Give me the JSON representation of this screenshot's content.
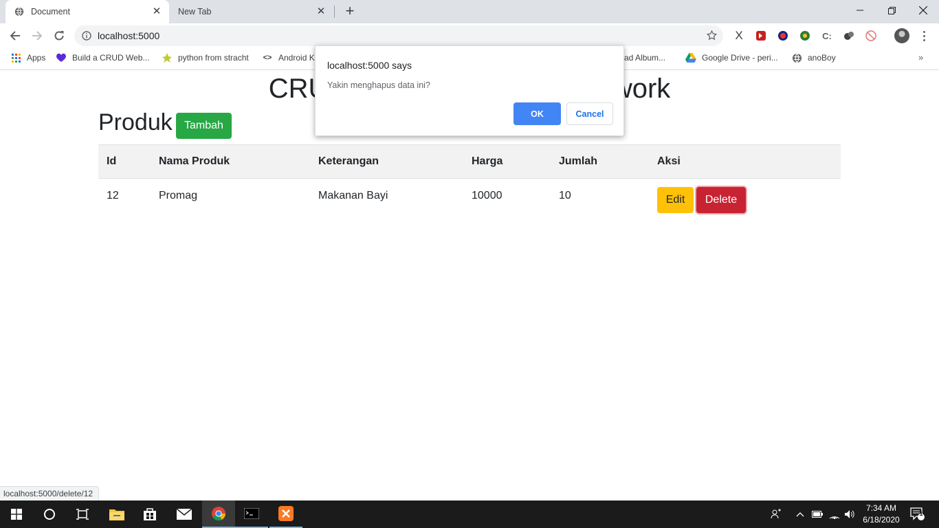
{
  "browser": {
    "tabs": [
      {
        "title": "Document"
      },
      {
        "title": "New Tab"
      }
    ],
    "url": "localhost:5000",
    "bookmarks": [
      {
        "label": "Apps"
      },
      {
        "label": "Build a CRUD Web..."
      },
      {
        "label": "python from stracht"
      },
      {
        "label": "Android K"
      },
      {
        "label": "ad Album..."
      },
      {
        "label": "Google Drive - peri..."
      },
      {
        "label": "anoBoy"
      }
    ],
    "status_url": "localhost:5000/delete/12"
  },
  "page": {
    "title": "CRUD Dengan Flask Framework",
    "section_title": "Produk",
    "add_button": "Tambah",
    "table": {
      "headers": [
        "Id",
        "Nama Produk",
        "Keterangan",
        "Harga",
        "Jumlah",
        "Aksi"
      ],
      "rows": [
        {
          "id": "12",
          "nama": "Promag",
          "keterangan": "Makanan Bayi",
          "harga": "10000",
          "jumlah": "10",
          "edit": "Edit",
          "delete": "Delete"
        }
      ]
    }
  },
  "dialog": {
    "title": "localhost:5000 says",
    "message": "Yakin menghapus data ini?",
    "ok": "OK",
    "cancel": "Cancel"
  },
  "taskbar": {
    "time": "7:34 AM",
    "date": "6/18/2020",
    "notification_count": "1"
  },
  "colors": {
    "success": "#28a745",
    "warning": "#ffc107",
    "danger": "#c82333",
    "dialog_ok": "#4285f4"
  }
}
